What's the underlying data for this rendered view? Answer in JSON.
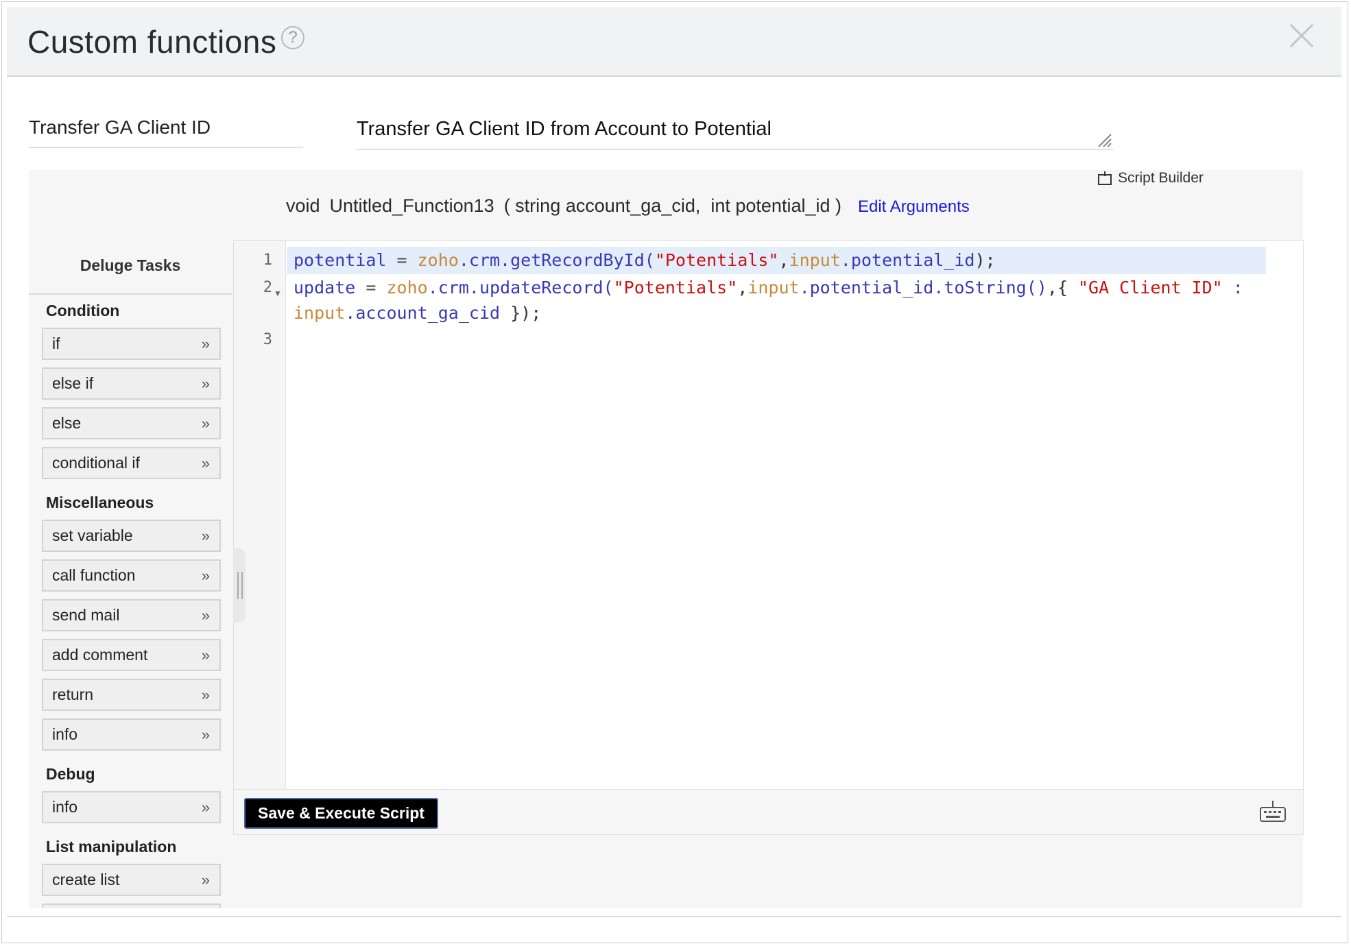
{
  "header": {
    "title": "Custom functions",
    "help_glyph": "?"
  },
  "function": {
    "name": "Transfer GA Client ID",
    "description": "Transfer GA Client ID from Account to Potential"
  },
  "toolbar": {
    "script_builder_label": "Script Builder"
  },
  "signature": {
    "return_type": "void",
    "name": "Untitled_Function13",
    "args": "( string account_ga_cid,  int potential_id )",
    "edit_label": "Edit Arguments"
  },
  "sidebar": {
    "title": "Deluge Tasks",
    "groups": [
      {
        "label": "Condition",
        "items": [
          "if",
          "else if",
          "else",
          "conditional if"
        ]
      },
      {
        "label": "Miscellaneous",
        "items": [
          "set variable",
          "call function",
          "send mail",
          "add comment",
          "return",
          "info"
        ]
      },
      {
        "label": "Debug",
        "items": [
          "info"
        ]
      },
      {
        "label": "List manipulation",
        "items": [
          "create list"
        ]
      }
    ]
  },
  "editor": {
    "line_numbers": [
      "1",
      "2",
      "3"
    ],
    "line1": {
      "var": "potential",
      "op": " = ",
      "obj": "zoho",
      "call": ".crm.getRecordById(",
      "str": "\"Potentials\"",
      "comma": ",",
      "inp": "input",
      "rest": ".potential_id",
      "end": ");"
    },
    "line2": {
      "var": "update",
      "op": " = ",
      "obj": "zoho",
      "call": ".crm.updateRecord(",
      "str": "\"Potentials\"",
      "comma": ",",
      "inp": "input",
      "rest": ".potential_id.toString()",
      "mid": ",{ ",
      "key": "\"GA Client ID\"",
      "colon": " :"
    },
    "line2b": {
      "inp": "input",
      "rest": ".account_ga_cid",
      "end": " });"
    }
  },
  "footer": {
    "save_label": "Save & Execute Script"
  },
  "icons": {
    "help": "help-icon",
    "close": "close-icon",
    "script_builder": "script-builder-icon",
    "chevron": "double-chevron-right-icon",
    "keyboard": "keyboard-icon"
  }
}
